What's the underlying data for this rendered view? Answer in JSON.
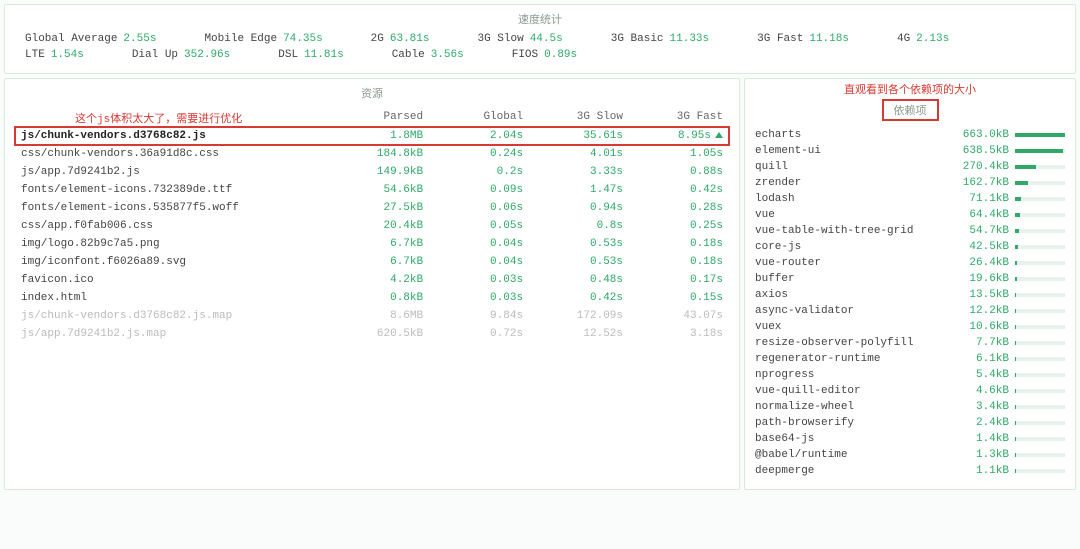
{
  "speed": {
    "title": "速度统计",
    "items": [
      {
        "label": "Global Average",
        "value": "2.55s"
      },
      {
        "label": "Mobile Edge",
        "value": "74.35s"
      },
      {
        "label": "2G",
        "value": "63.81s"
      },
      {
        "label": "3G Slow",
        "value": "44.5s"
      },
      {
        "label": "3G Basic",
        "value": "11.33s"
      },
      {
        "label": "3G Fast",
        "value": "11.18s"
      },
      {
        "label": "4G",
        "value": "2.13s"
      },
      {
        "label": "LTE",
        "value": "1.54s"
      },
      {
        "label": "Dial Up",
        "value": "352.96s"
      },
      {
        "label": "DSL",
        "value": "11.81s"
      },
      {
        "label": "Cable",
        "value": "3.56s"
      },
      {
        "label": "FIOS",
        "value": "0.89s"
      }
    ]
  },
  "resources": {
    "title": "资源",
    "note": "这个js体积太大了，需要进行优化",
    "columns": [
      "",
      "Parsed",
      "Global",
      "3G Slow",
      "3G Fast"
    ],
    "rows": [
      {
        "file": "js/chunk-vendors.d3768c82.js",
        "parsed": "1.8MB",
        "global": "2.04s",
        "slow": "35.61s",
        "fast": "8.95s",
        "highlighted": true,
        "tri": true
      },
      {
        "file": "css/chunk-vendors.36a91d8c.css",
        "parsed": "184.8kB",
        "global": "0.24s",
        "slow": "4.01s",
        "fast": "1.05s"
      },
      {
        "file": "js/app.7d9241b2.js",
        "parsed": "149.9kB",
        "global": "0.2s",
        "slow": "3.33s",
        "fast": "0.88s"
      },
      {
        "file": "fonts/element-icons.732389de.ttf",
        "parsed": "54.6kB",
        "global": "0.09s",
        "slow": "1.47s",
        "fast": "0.42s"
      },
      {
        "file": "fonts/element-icons.535877f5.woff",
        "parsed": "27.5kB",
        "global": "0.06s",
        "slow": "0.94s",
        "fast": "0.28s"
      },
      {
        "file": "css/app.f0fab006.css",
        "parsed": "20.4kB",
        "global": "0.05s",
        "slow": "0.8s",
        "fast": "0.25s"
      },
      {
        "file": "img/logo.82b9c7a5.png",
        "parsed": "6.7kB",
        "global": "0.04s",
        "slow": "0.53s",
        "fast": "0.18s"
      },
      {
        "file": "img/iconfont.f6026a89.svg",
        "parsed": "6.7kB",
        "global": "0.04s",
        "slow": "0.53s",
        "fast": "0.18s"
      },
      {
        "file": "favicon.ico",
        "parsed": "4.2kB",
        "global": "0.03s",
        "slow": "0.48s",
        "fast": "0.17s"
      },
      {
        "file": "index.html",
        "parsed": "0.8kB",
        "global": "0.03s",
        "slow": "0.42s",
        "fast": "0.15s"
      },
      {
        "file": "js/chunk-vendors.d3768c82.js.map",
        "parsed": "8.6MB",
        "global": "9.84s",
        "slow": "172.09s",
        "fast": "43.07s",
        "muted": true
      },
      {
        "file": "js/app.7d9241b2.js.map",
        "parsed": "620.5kB",
        "global": "0.72s",
        "slow": "12.52s",
        "fast": "3.18s",
        "muted": true
      }
    ]
  },
  "deps": {
    "title": "依赖项",
    "note": "直观看到各个依赖项的大小",
    "maxKB": 663.0,
    "rows": [
      {
        "name": "echarts",
        "size": "663.0kB",
        "kb": 663.0
      },
      {
        "name": "element-ui",
        "size": "638.5kB",
        "kb": 638.5
      },
      {
        "name": "quill",
        "size": "270.4kB",
        "kb": 270.4
      },
      {
        "name": "zrender",
        "size": "162.7kB",
        "kb": 162.7
      },
      {
        "name": "lodash",
        "size": "71.1kB",
        "kb": 71.1
      },
      {
        "name": "vue",
        "size": "64.4kB",
        "kb": 64.4
      },
      {
        "name": "vue-table-with-tree-grid",
        "size": "54.7kB",
        "kb": 54.7
      },
      {
        "name": "core-js",
        "size": "42.5kB",
        "kb": 42.5
      },
      {
        "name": "vue-router",
        "size": "26.4kB",
        "kb": 26.4
      },
      {
        "name": "buffer",
        "size": "19.6kB",
        "kb": 19.6
      },
      {
        "name": "axios",
        "size": "13.5kB",
        "kb": 13.5
      },
      {
        "name": "async-validator",
        "size": "12.2kB",
        "kb": 12.2
      },
      {
        "name": "vuex",
        "size": "10.6kB",
        "kb": 10.6
      },
      {
        "name": "resize-observer-polyfill",
        "size": "7.7kB",
        "kb": 7.7
      },
      {
        "name": "regenerator-runtime",
        "size": "6.1kB",
        "kb": 6.1
      },
      {
        "name": "nprogress",
        "size": "5.4kB",
        "kb": 5.4
      },
      {
        "name": "vue-quill-editor",
        "size": "4.6kB",
        "kb": 4.6
      },
      {
        "name": "normalize-wheel",
        "size": "3.4kB",
        "kb": 3.4
      },
      {
        "name": "path-browserify",
        "size": "2.4kB",
        "kb": 2.4
      },
      {
        "name": "base64-js",
        "size": "1.4kB",
        "kb": 1.4
      },
      {
        "name": "@babel/runtime",
        "size": "1.3kB",
        "kb": 1.3
      },
      {
        "name": "deepmerge",
        "size": "1.1kB",
        "kb": 1.1
      }
    ]
  }
}
